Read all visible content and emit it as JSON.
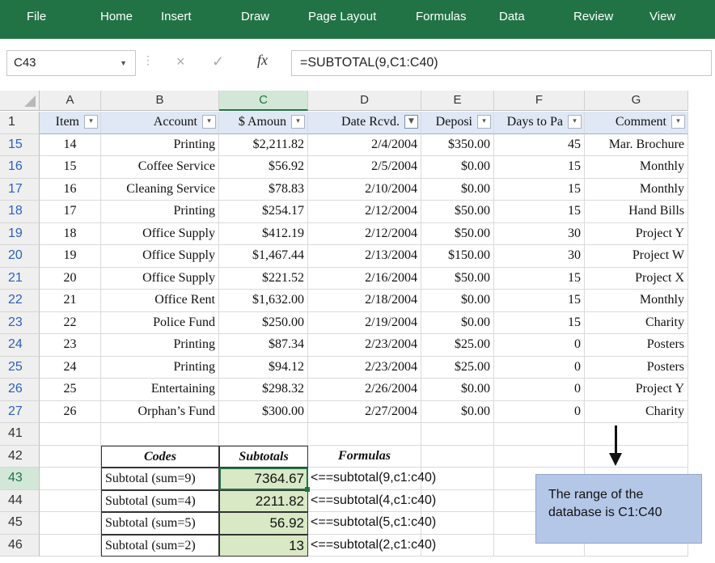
{
  "ribbon": {
    "bg_color": "#217346",
    "tabs": [
      "File",
      "Home",
      "Insert",
      "Draw",
      "Page Layout",
      "Formulas",
      "Data",
      "Review",
      "View"
    ]
  },
  "formula_bar": {
    "name_box": "C43",
    "fx_label": "fx",
    "cancel_icon": "×",
    "enter_icon": "✓",
    "formula": "=SUBTOTAL(9,C1:C40)"
  },
  "columns": [
    "A",
    "B",
    "C",
    "D",
    "E",
    "F",
    "G"
  ],
  "selected_column": "C",
  "table_headers": [
    {
      "col": "A",
      "label": "Item",
      "filter": "dropdown"
    },
    {
      "col": "B",
      "label": "Account",
      "filter": "dropdown"
    },
    {
      "col": "C",
      "label": "$ Amoun",
      "filter": "dropdown"
    },
    {
      "col": "D",
      "label": "Date Rcvd.",
      "filter": "filtered"
    },
    {
      "col": "E",
      "label": "Deposi",
      "filter": "dropdown"
    },
    {
      "col": "F",
      "label": "Days to Pa",
      "filter": "dropdown"
    },
    {
      "col": "G",
      "label": "Comment",
      "filter": "dropdown"
    }
  ],
  "rows": [
    {
      "row": "15",
      "item": "14",
      "account": "Printing",
      "amount": "$2,211.82",
      "date": "2/4/2004",
      "deposit": "$350.00",
      "days": "45",
      "comment": "Mar. Brochure"
    },
    {
      "row": "16",
      "item": "15",
      "account": "Coffee Service",
      "amount": "$56.92",
      "date": "2/5/2004",
      "deposit": "$0.00",
      "days": "15",
      "comment": "Monthly"
    },
    {
      "row": "17",
      "item": "16",
      "account": "Cleaning Service",
      "amount": "$78.83",
      "date": "2/10/2004",
      "deposit": "$0.00",
      "days": "15",
      "comment": "Monthly"
    },
    {
      "row": "18",
      "item": "17",
      "account": "Printing",
      "amount": "$254.17",
      "date": "2/12/2004",
      "deposit": "$50.00",
      "days": "15",
      "comment": "Hand Bills"
    },
    {
      "row": "19",
      "item": "18",
      "account": "Office Supply",
      "amount": "$412.19",
      "date": "2/12/2004",
      "deposit": "$50.00",
      "days": "30",
      "comment": "Project Y"
    },
    {
      "row": "20",
      "item": "19",
      "account": "Office Supply",
      "amount": "$1,467.44",
      "date": "2/13/2004",
      "deposit": "$150.00",
      "days": "30",
      "comment": "Project W"
    },
    {
      "row": "21",
      "item": "20",
      "account": "Office Supply",
      "amount": "$221.52",
      "date": "2/16/2004",
      "deposit": "$50.00",
      "days": "15",
      "comment": "Project X"
    },
    {
      "row": "22",
      "item": "21",
      "account": "Office Rent",
      "amount": "$1,632.00",
      "date": "2/18/2004",
      "deposit": "$0.00",
      "days": "15",
      "comment": "Monthly"
    },
    {
      "row": "23",
      "item": "22",
      "account": "Police Fund",
      "amount": "$250.00",
      "date": "2/19/2004",
      "deposit": "$0.00",
      "days": "15",
      "comment": "Charity"
    },
    {
      "row": "24",
      "item": "23",
      "account": "Printing",
      "amount": "$87.34",
      "date": "2/23/2004",
      "deposit": "$25.00",
      "days": "0",
      "comment": "Posters"
    },
    {
      "row": "25",
      "item": "24",
      "account": "Printing",
      "amount": "$94.12",
      "date": "2/23/2004",
      "deposit": "$25.00",
      "days": "0",
      "comment": "Posters"
    },
    {
      "row": "26",
      "item": "25",
      "account": "Entertaining",
      "amount": "$298.32",
      "date": "2/26/2004",
      "deposit": "$0.00",
      "days": "0",
      "comment": "Project Y"
    },
    {
      "row": "27",
      "item": "26",
      "account": "Orphan’s Fund",
      "amount": "$300.00",
      "date": "2/27/2004",
      "deposit": "$0.00",
      "days": "0",
      "comment": "Charity"
    }
  ],
  "header_row_number": "1",
  "blank_row_number": "41",
  "summary": {
    "header_row_number": "42",
    "codes_label": "Codes",
    "subtotals_label": "Subtotals",
    "formulas_label": "Formulas",
    "rows": [
      {
        "row": "43",
        "code": "Subtotal (sum=9)",
        "value": "7364.67",
        "formula": "<==subtotal(9,c1:c40)"
      },
      {
        "row": "44",
        "code": "Subtotal (sum=4)",
        "value": "2211.82",
        "formula": "<==subtotal(4,c1:c40)"
      },
      {
        "row": "45",
        "code": "Subtotal (sum=5)",
        "value": "56.92",
        "formula": "<==subtotal(5,c1:c40)"
      },
      {
        "row": "46",
        "code": "Subtotal (sum=2)",
        "value": "13",
        "formula": "<==subtotal(2,c1:c40)"
      }
    ]
  },
  "active_cell": "C43",
  "note": {
    "text": "The range of the database is C1:C40"
  },
  "colors": {
    "header_fill": "#dfe8f4",
    "subtotal_fill": "#d9e8c5",
    "note_fill": "#b4c7e7",
    "filtered_row_number": "#2c5fc0"
  }
}
